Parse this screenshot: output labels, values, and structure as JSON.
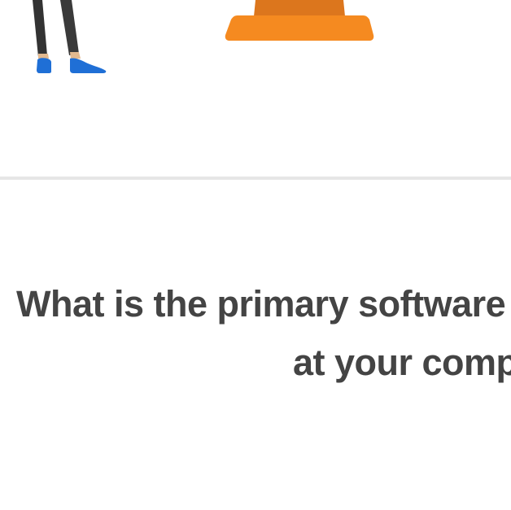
{
  "question": {
    "line1": "What is the primary software",
    "line2": "at your company?"
  },
  "colors": {
    "background": "#ffffff",
    "divider": "#e6e6e6",
    "question_text": "#444444",
    "cone_orange": "#f58a20",
    "cone_dark": "#e27b1c",
    "shoe_blue": "#1f6fd6",
    "legs": "#333333"
  },
  "icons": {
    "person": "person-illustration",
    "cone": "traffic-cone-illustration"
  }
}
